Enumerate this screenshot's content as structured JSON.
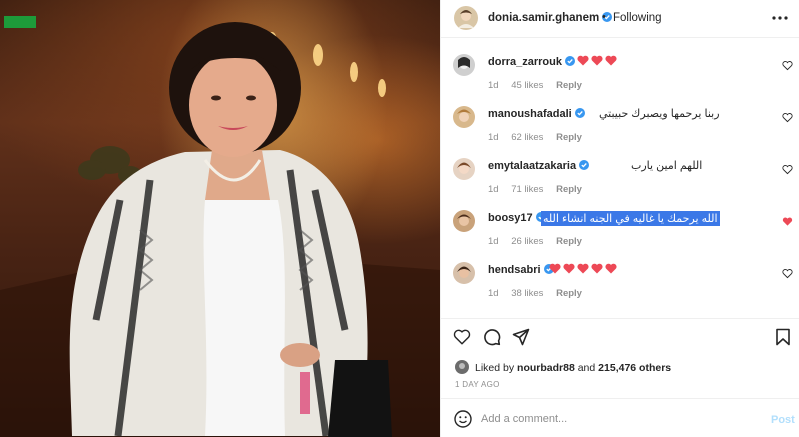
{
  "header": {
    "username": "donia.samir.ghanem",
    "separator": "•",
    "follow_label": "Following"
  },
  "comments": [
    {
      "username": "dorra_zarrouk",
      "verified": true,
      "text": "",
      "hearts": 3,
      "time": "1d",
      "likes": "45 likes",
      "reply": "Reply",
      "liked": false
    },
    {
      "username": "manoushafadali",
      "verified": true,
      "text": "ربنا يرحمها ويصبرك حبيبتي",
      "hearts": 0,
      "time": "1d",
      "likes": "62 likes",
      "reply": "Reply",
      "liked": false
    },
    {
      "username": "emytalaatzakaria",
      "verified": true,
      "text": "اللهم امين يارب",
      "hearts": 0,
      "time": "1d",
      "likes": "71 likes",
      "reply": "Reply",
      "liked": false
    },
    {
      "username": "boosy17",
      "verified": true,
      "text": "الله يرحمك يا غاليه في الجنه انشاء الله",
      "hearts": 0,
      "time": "1d",
      "likes": "26 likes",
      "reply": "Reply",
      "liked": true
    },
    {
      "username": "hendsabri",
      "verified": true,
      "text": "",
      "hearts": 5,
      "time": "1d",
      "likes": "38 likes",
      "reply": "Reply",
      "liked": false
    }
  ],
  "likes": {
    "prefix": "Liked by",
    "user": "nourbadr88",
    "and": "and",
    "others": "215,476 others"
  },
  "timestamp": "1 DAY AGO",
  "add_comment": {
    "placeholder": "Add a comment...",
    "post_label": "Post"
  },
  "colors": {
    "heart_red": "#ed4956",
    "verified_blue": "#3897f0",
    "highlight": "#3b78e7",
    "post_disabled": "#b2dffc"
  }
}
